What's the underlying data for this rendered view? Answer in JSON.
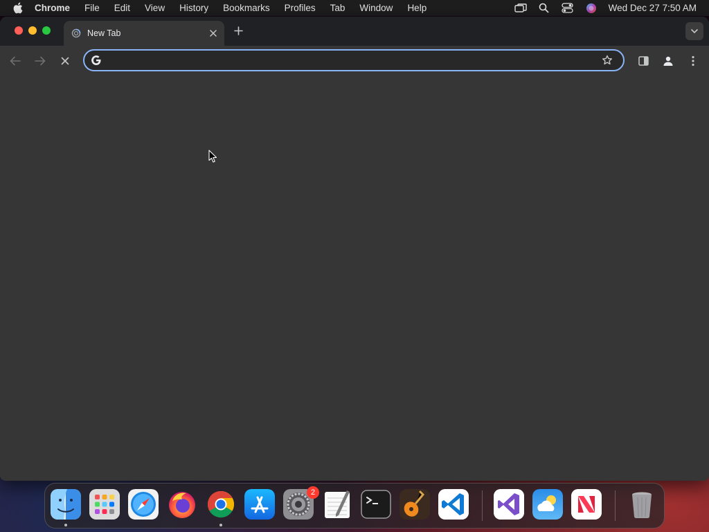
{
  "menubar": {
    "app_name": "Chrome",
    "items": [
      "File",
      "Edit",
      "View",
      "History",
      "Bookmarks",
      "Profiles",
      "Tab",
      "Window",
      "Help"
    ],
    "clock": "Wed Dec 27  7:50 AM"
  },
  "browser": {
    "tab": {
      "title": "New Tab"
    },
    "omnibox": {
      "value": "",
      "placeholder": ""
    }
  },
  "dock": {
    "apps": [
      "finder",
      "launchpad",
      "safari",
      "firefox",
      "chrome",
      "app-store",
      "system-settings",
      "textedit",
      "terminal",
      "garageband",
      "vscode",
      "visual-studio",
      "weather",
      "news",
      "trash"
    ],
    "settings_badge": "2"
  },
  "colors": {
    "accent": "#8ab4f8",
    "window_bg": "#363636",
    "tabstrip_bg": "#202124"
  }
}
